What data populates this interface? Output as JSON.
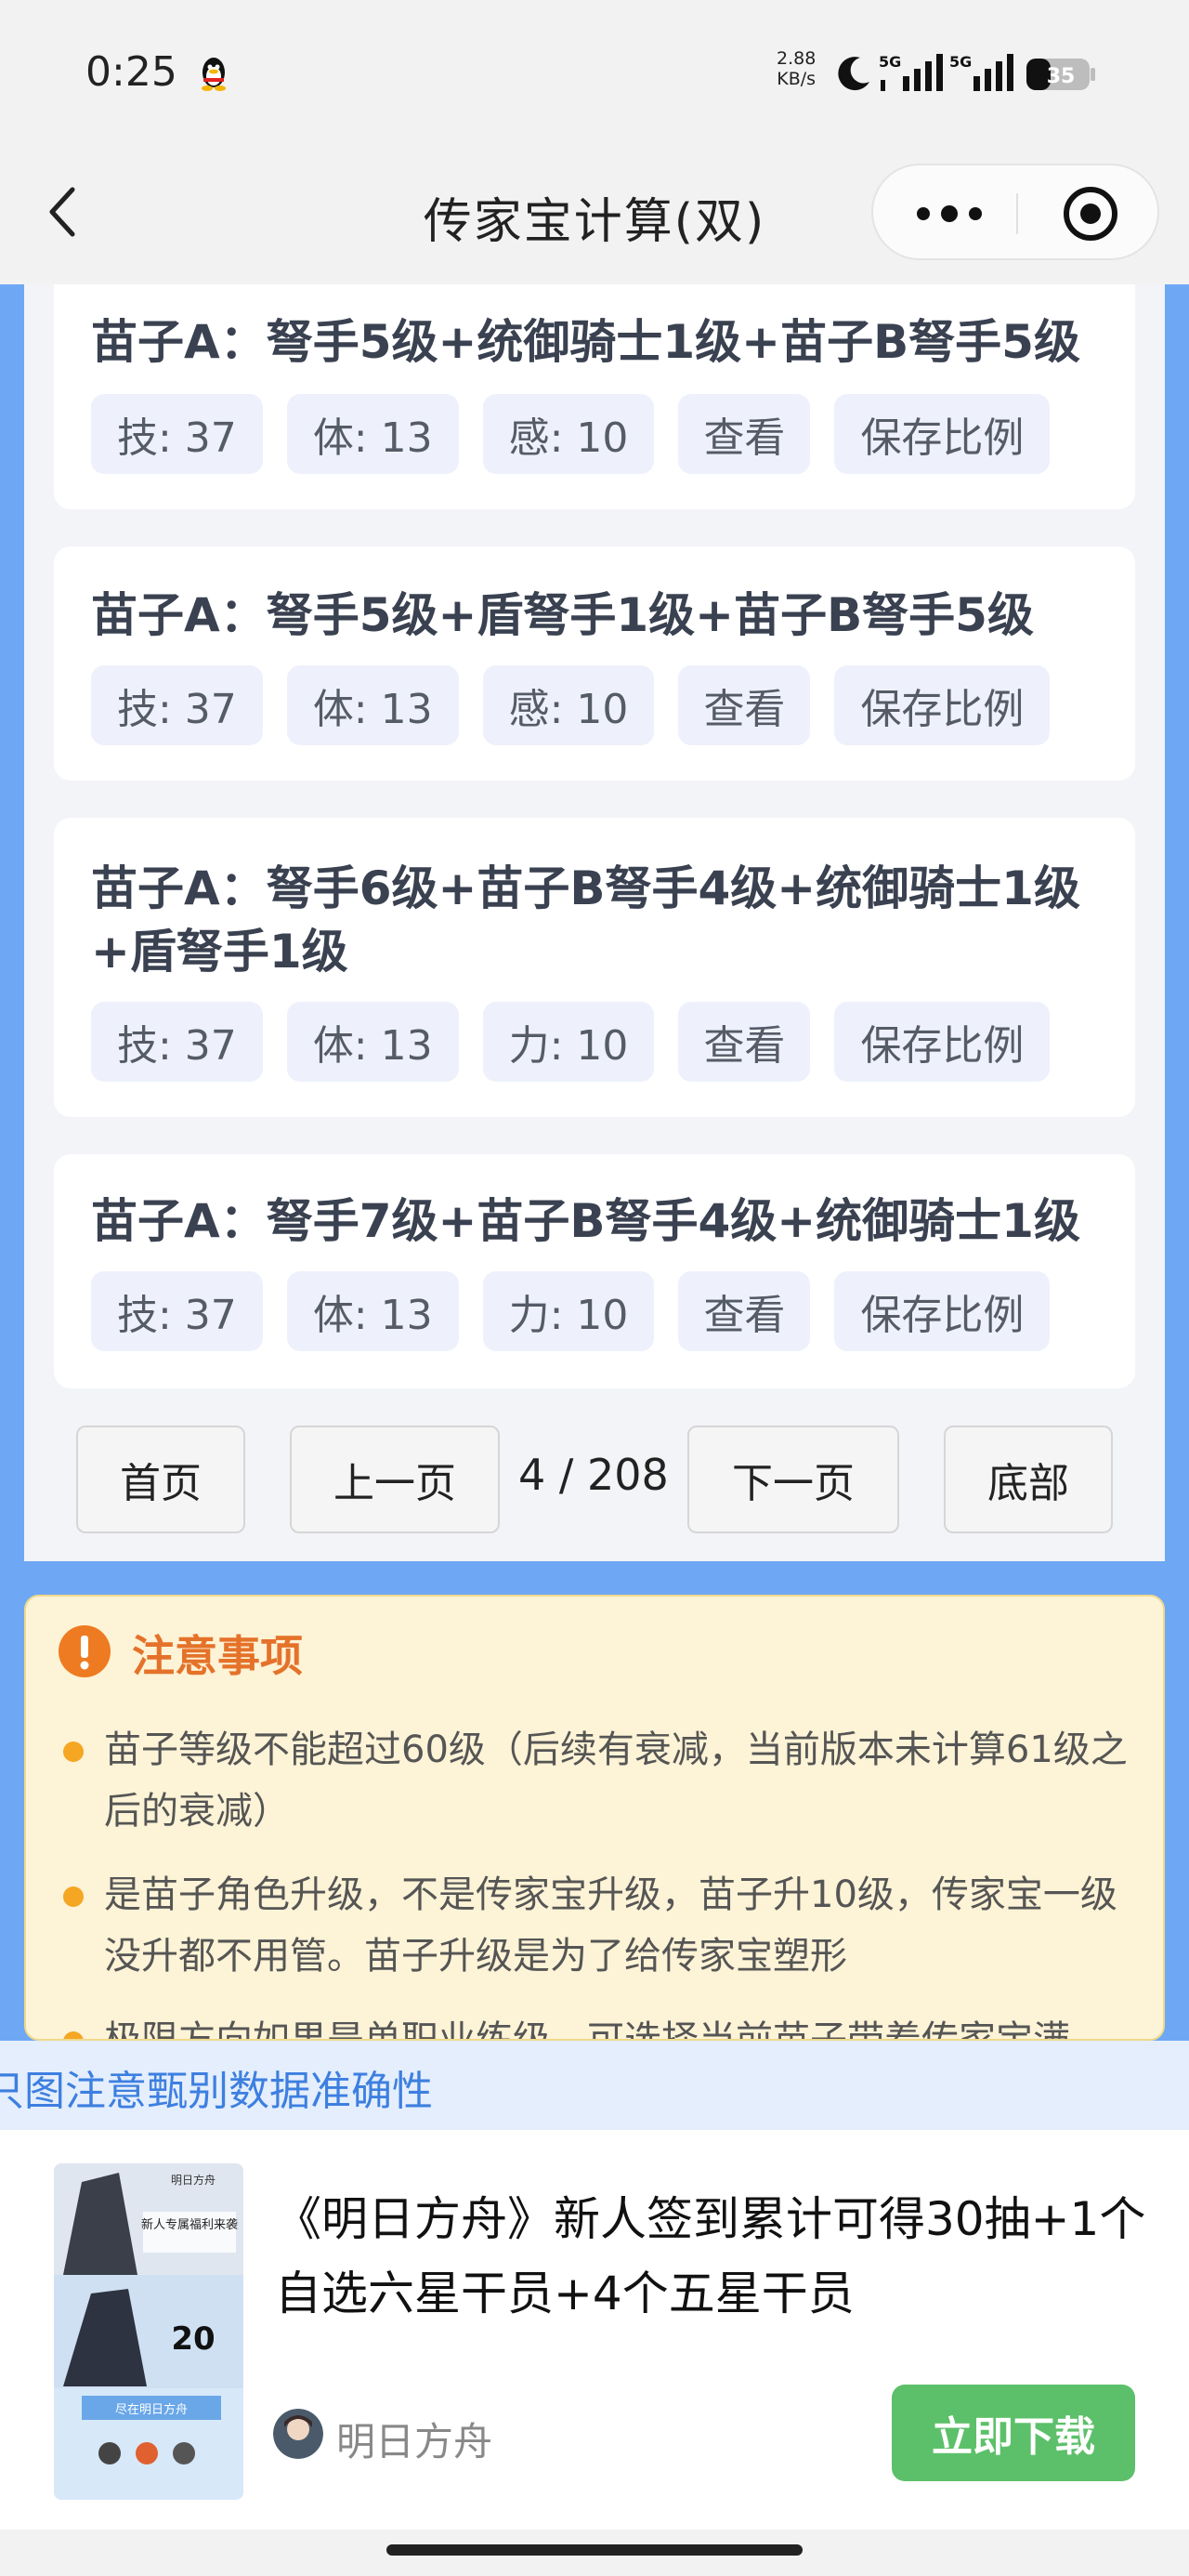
{
  "status_bar": {
    "time": "0:25",
    "net_speed_value": "2.88",
    "net_speed_unit": "KB/s",
    "signal1_label": "5G",
    "signal2_label": "5G",
    "battery": "35"
  },
  "nav": {
    "title": "传家宝计算(双)"
  },
  "results": [
    {
      "title": "苗子A：弩手5级+统御骑士1级+苗子B弩手5级",
      "stats": [
        "技: 37",
        "体: 13",
        "感: 10"
      ]
    },
    {
      "title": "苗子A：弩手5级+盾弩手1级+苗子B弩手5级",
      "stats": [
        "技: 37",
        "体: 13",
        "感: 10"
      ]
    },
    {
      "title": "苗子A：弩手6级+苗子B弩手4级+统御骑士1级+盾弩手1级",
      "stats": [
        "技: 37",
        "体: 13",
        "力: 10"
      ]
    },
    {
      "title": "苗子A：弩手7级+苗子B弩手4级+统御骑士1级",
      "stats": [
        "技: 37",
        "体: 13",
        "力: 10"
      ]
    }
  ],
  "actions": {
    "view": "查看",
    "save": "保存比例"
  },
  "pager": {
    "first": "首页",
    "prev": "上一页",
    "page_info": "4 / 208",
    "next": "下一页",
    "last": "底部"
  },
  "notice": {
    "title": "注意事项",
    "items": [
      "苗子等级不能超过60级（后续有衰减，当前版本未计算61级之后的衰减）",
      "是苗子角色升级，不是传家宝升级，苗子升10级，传家宝一级没升都不用管。苗子升级是为了给传家宝塑形",
      "极限方向如果是单职业练级，可选择当前苗子带着传家宝满"
    ]
  },
  "banner": {
    "text": "只图注意甄别数据准确性"
  },
  "ad": {
    "title": "《明日方舟》新人签到累计可得30抽+1个自选六星干员+4个五星干员",
    "brand": "明日方舟",
    "button": "立即下载",
    "thumb_text1": "新人专属福利来袭",
    "thumb_text2": "20",
    "thumb_text3": "尽在明日方舟",
    "thumb_text4": "明日方舟"
  },
  "colors": {
    "frame_blue": "#6ea8f5",
    "notice_orange": "#e5722a",
    "download_green": "#5cc06a",
    "banner_blue": "#3d7fe0"
  }
}
